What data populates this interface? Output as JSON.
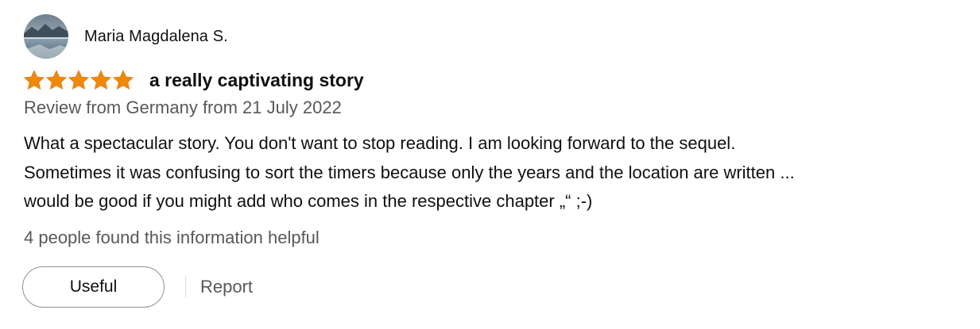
{
  "reviewer": {
    "name": "Maria Magdalena S.",
    "avatar_icon": "lake-landscape-avatar"
  },
  "rating": {
    "stars": 5,
    "max_stars": 5,
    "star_color": "#f08804"
  },
  "review": {
    "title": "a really captivating story",
    "meta": "Review from Germany from 21 July 2022",
    "body_lines": [
      "What a spectacular story. You don't want to stop reading. I am looking forward to the sequel.",
      "Sometimes it was confusing to sort the timers because only the years and the location are written ...",
      "would be good if you might add who comes in the respective chapter „“ ;-)"
    ]
  },
  "helpful": {
    "count_text": "4 people found this information helpful"
  },
  "actions": {
    "useful_label": "Useful",
    "report_label": "Report"
  }
}
